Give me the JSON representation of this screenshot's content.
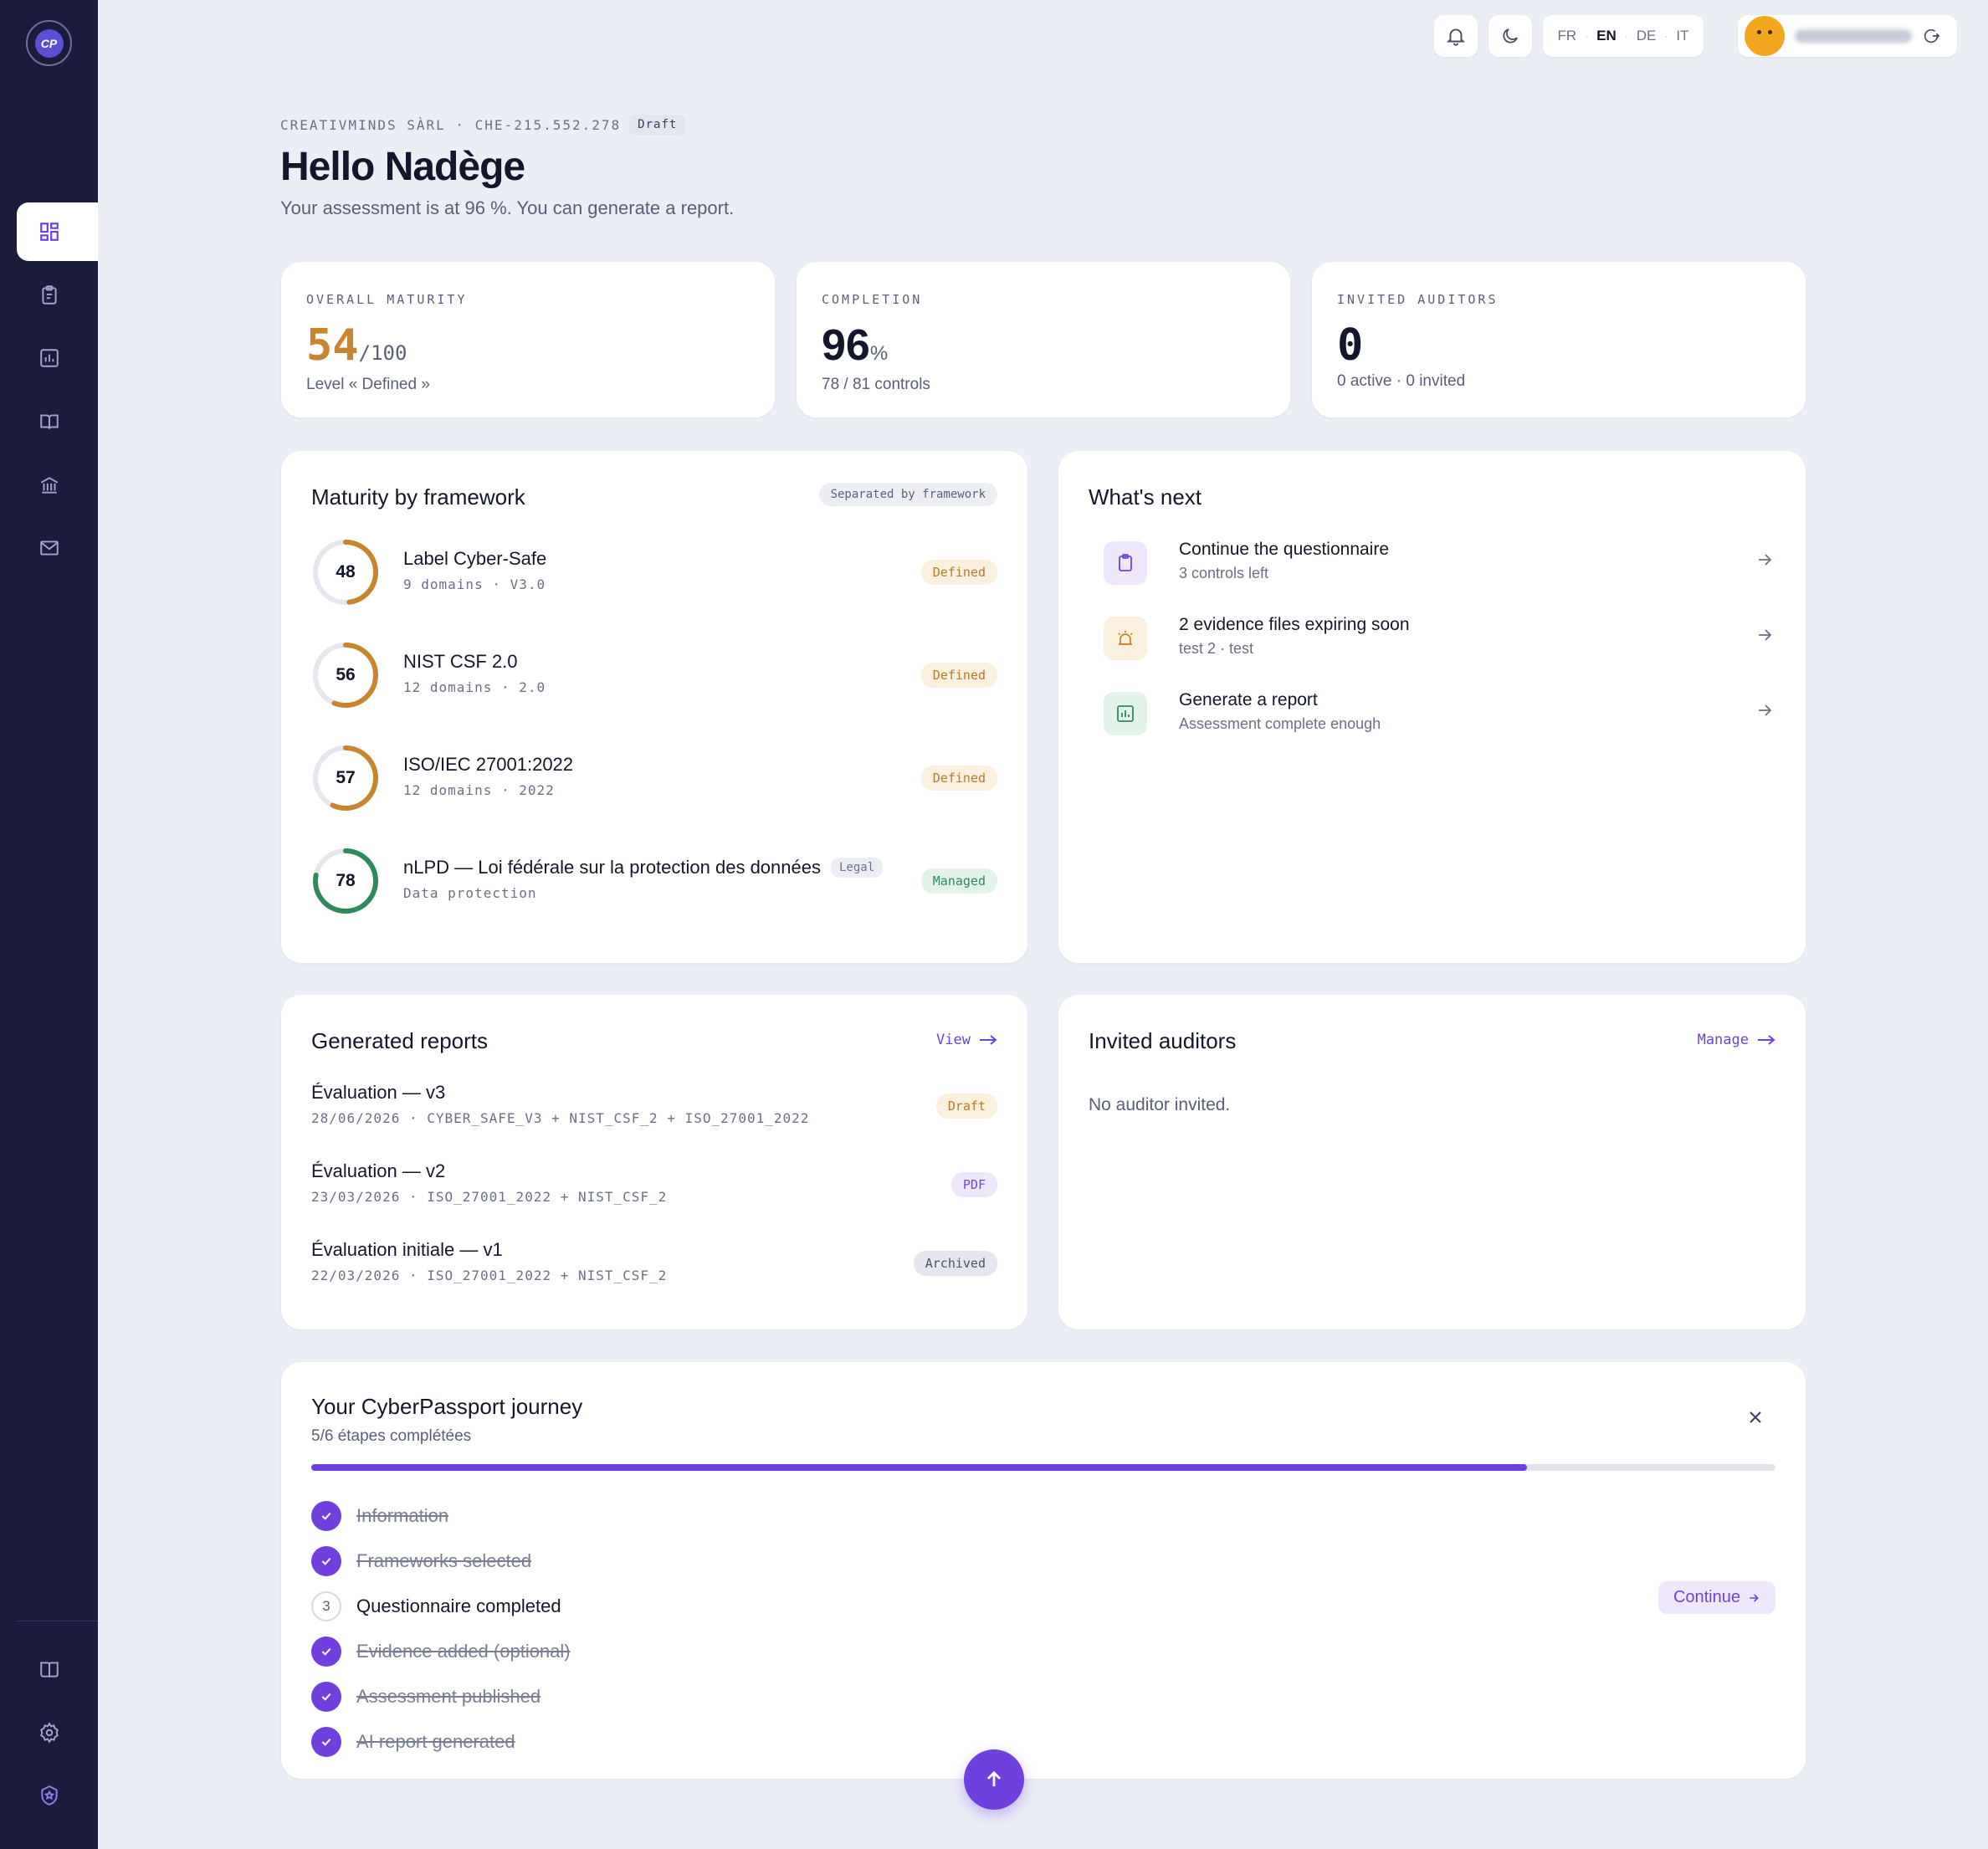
{
  "topbar": {
    "languages": [
      "FR",
      "EN",
      "DE",
      "IT"
    ],
    "active_language": "EN"
  },
  "header": {
    "company": "CREATIVMINDS SÀRL · CHE-215.552.278",
    "status": "Draft",
    "greeting": "Hello Nadège",
    "subtitle": "Your assessment is at 96 %. You can generate a report."
  },
  "kpis": {
    "maturity": {
      "label": "OVERALL MATURITY",
      "value": "54",
      "suffix": "/100",
      "sub": "Level « Defined »"
    },
    "completion": {
      "label": "COMPLETION",
      "value": "96",
      "suffix": "%",
      "sub": "78 / 81 controls"
    },
    "auditors": {
      "label": "INVITED AUDITORS",
      "value": "0",
      "sub": "0 active · 0 invited"
    }
  },
  "frameworks": {
    "title": "Maturity by framework",
    "tag": "Separated by framework",
    "items": [
      {
        "score": 48,
        "name": "Label Cyber-Safe",
        "meta": "9 domains · V3.0",
        "level": "Defined",
        "color": "#c8842f",
        "legal": ""
      },
      {
        "score": 56,
        "name": "NIST CSF 2.0",
        "meta": "12 domains · 2.0",
        "level": "Defined",
        "color": "#c8842f",
        "legal": ""
      },
      {
        "score": 57,
        "name": "ISO/IEC 27001:2022",
        "meta": "12 domains · 2022",
        "level": "Defined",
        "color": "#c8842f",
        "legal": ""
      },
      {
        "score": 78,
        "name": "nLPD — Loi fédérale sur la protection des données",
        "meta": "Data protection",
        "level": "Managed",
        "color": "#2e8a5d",
        "legal": "Legal"
      }
    ]
  },
  "next": {
    "title": "What's next",
    "items": [
      {
        "icon": "clipboard-icon",
        "title": "Continue the questionnaire",
        "sub": "3 controls left"
      },
      {
        "icon": "alarm-icon",
        "title": "2 evidence files expiring soon",
        "sub": "test 2 · test"
      },
      {
        "icon": "chart-icon",
        "title": "Generate a report",
        "sub": "Assessment complete enough"
      }
    ]
  },
  "reports": {
    "title": "Generated reports",
    "view_label": "View",
    "items": [
      {
        "title": "Évaluation — v3",
        "meta": "28/06/2026 · CYBER_SAFE_V3 + NIST_CSF_2 + ISO_27001_2022",
        "badge": "Draft"
      },
      {
        "title": "Évaluation — v2",
        "meta": "23/03/2026 · ISO_27001_2022 + NIST_CSF_2",
        "badge": "PDF"
      },
      {
        "title": "Évaluation initiale — v1",
        "meta": "22/03/2026 · ISO_27001_2022 + NIST_CSF_2",
        "badge": "Archived"
      }
    ]
  },
  "auditors": {
    "title": "Invited auditors",
    "manage_label": "Manage",
    "empty": "No auditor invited."
  },
  "journey": {
    "title": "Your CyberPassport journey",
    "sub": "5/6 étapes complétées",
    "progress": 0.83,
    "continue_label": "Continue",
    "steps": [
      {
        "label": "Information",
        "done": true
      },
      {
        "label": "Frameworks selected",
        "done": true
      },
      {
        "label": "Questionnaire completed",
        "done": false,
        "num": "3"
      },
      {
        "label": "Evidence added (optional)",
        "done": true
      },
      {
        "label": "Assessment published",
        "done": true
      },
      {
        "label": "AI report generated",
        "done": true
      }
    ]
  },
  "colors": {
    "accent": "#7040de",
    "sidebar": "#1b1c3c",
    "defined": "#c8842f",
    "managed": "#2e8a5d"
  }
}
